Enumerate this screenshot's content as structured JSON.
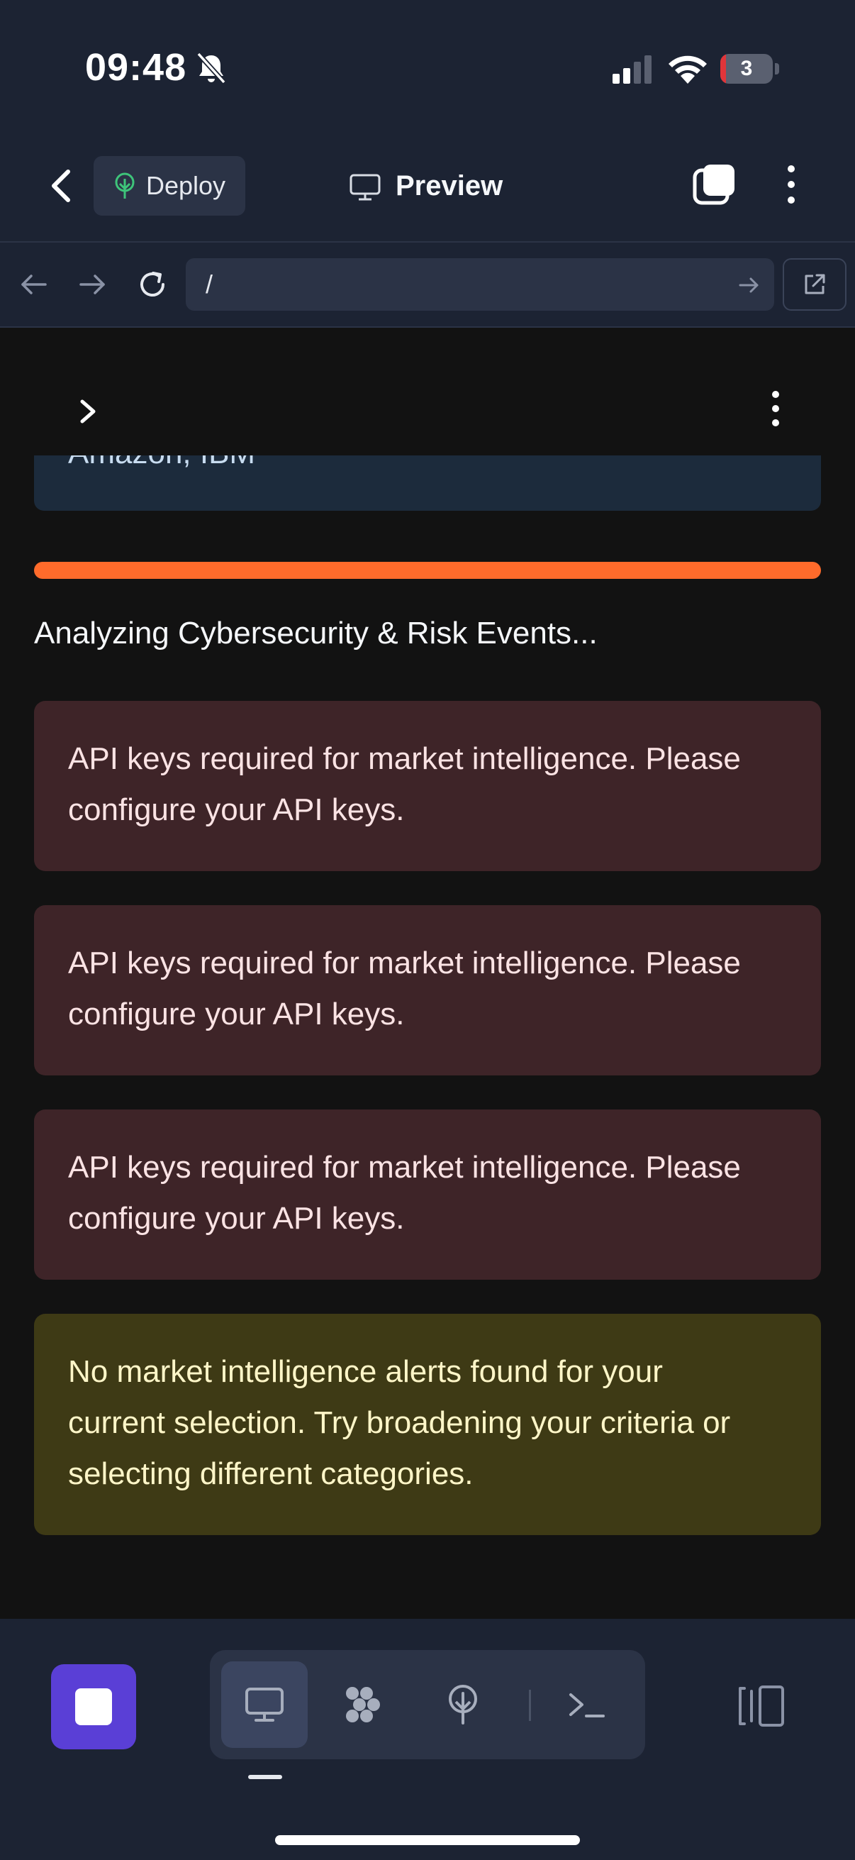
{
  "status_bar": {
    "time": "09:48",
    "battery_level": "3"
  },
  "app_bar": {
    "deploy_label": "Deploy",
    "preview_label": "Preview"
  },
  "url_bar": {
    "url": "/"
  },
  "content": {
    "partial_box_text": "Amazon, IBM",
    "progress_color": "#ff6b2b",
    "status_text": "Analyzing Cybersecurity & Risk Events...",
    "alerts": [
      {
        "type": "error",
        "line1": "API keys required for market intelligence. Please",
        "line2": "configure your API keys."
      },
      {
        "type": "error",
        "line1": "API keys required for market intelligence. Please",
        "line2": "configure your API keys."
      },
      {
        "type": "error",
        "line1": "API keys required for market intelligence. Please",
        "line2": "configure your API keys."
      }
    ],
    "warning": {
      "line1": "No market intelligence alerts found for your",
      "line2": "current selection. Try broadening your criteria or",
      "line3": "selecting different categories."
    }
  },
  "bottom_bar": {
    "stop_color": "#5a3fd6",
    "tools": [
      "desktop-icon",
      "hexagon-cluster-icon",
      "globe-antenna-icon",
      "terminal-icon"
    ],
    "active_tool": "desktop-icon"
  },
  "colors": {
    "chrome_bg": "#1c2333",
    "content_bg": "#121212",
    "error_bg": "#3e2428",
    "warning_bg": "#3e3a15"
  }
}
